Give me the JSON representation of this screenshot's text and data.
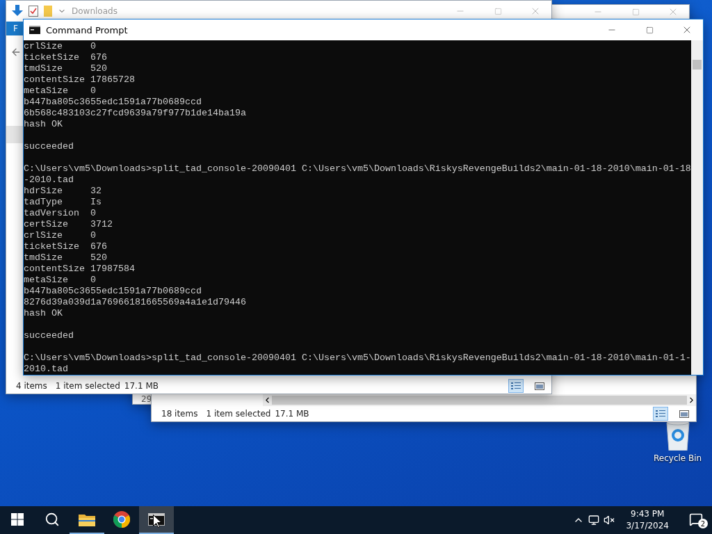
{
  "desktop": {
    "recycle_bin": {
      "label": "Recycle Bin"
    }
  },
  "back_windows": [
    {
      "column_text": "29"
    },
    {
      "item_count": "18 items",
      "selection": "1 item selected",
      "selection_size": "17.1 MB",
      "views": [
        {
          "kind": "details",
          "selected": true
        },
        {
          "kind": "large-icons",
          "selected": false
        }
      ]
    }
  ],
  "explorer": {
    "title": "Downloads",
    "ribbon_tab": "F",
    "item_count": "4 items",
    "selection": "1 item selected",
    "selection_size": "17.1 MB",
    "views": [
      {
        "kind": "details",
        "selected": true
      },
      {
        "kind": "large-icons",
        "selected": false
      }
    ]
  },
  "console": {
    "title": "Command Prompt",
    "blocks": [
      [
        "crlSize     0",
        "ticketSize  676",
        "tmdSize     520",
        "contentSize 17865728",
        "metaSize    0",
        "b447ba805c3655edc1591a77b0689ccd",
        "6b568c483103c27fcd9639a79f977b1de14ba19a",
        "hash OK"
      ],
      [
        "succeeded"
      ],
      [
        "C:\\Users\\vm5\\Downloads>split_tad_console-20090401 C:\\Users\\vm5\\Downloads\\RiskysRevengeBuilds2\\main-01-18-2010\\main-01-18",
        "-2010.tad",
        "hdrSize     32",
        "tadType     Is",
        "tadVersion  0",
        "certSize    3712",
        "crlSize     0",
        "ticketSize  676",
        "tmdSize     520",
        "contentSize 17987584",
        "metaSize    0",
        "b447ba805c3655edc1591a77b0689ccd",
        "8276d39a039d1a76966181665569a4a1e1d79446",
        "hash OK"
      ],
      [
        "succeeded"
      ],
      [
        "C:\\Users\\vm5\\Downloads>split_tad_console-20090401 C:\\Users\\vm5\\Downloads\\RiskysRevengeBuilds2\\main-01-18-2010\\main-01-1-",
        "2010.tad"
      ]
    ]
  },
  "taskbar": {
    "apps": [
      {
        "kind": "explorer",
        "running": true,
        "selected": false
      },
      {
        "kind": "chrome",
        "running": false,
        "selected": false
      },
      {
        "kind": "terminal",
        "running": true,
        "selected": true
      }
    ],
    "tray": {
      "time": "9:43 PM",
      "date": "3/17/2024",
      "notifications": "2"
    }
  }
}
